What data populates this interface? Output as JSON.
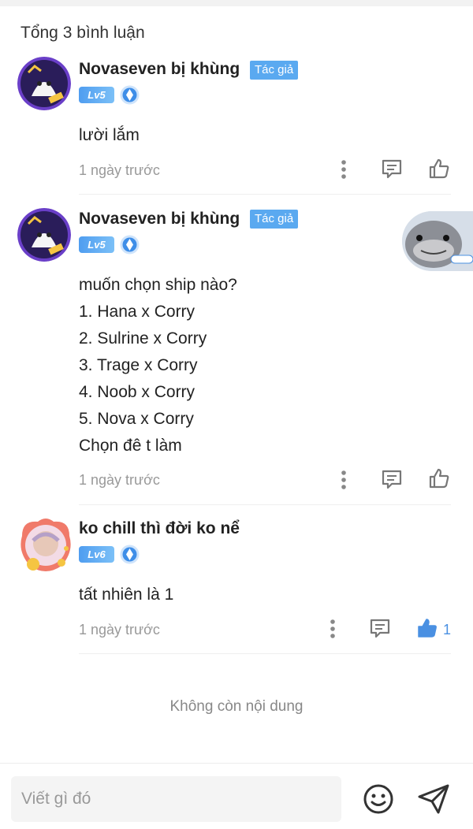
{
  "header": {
    "total": "Tổng 3 bình luận"
  },
  "comments": [
    {
      "author": "Novaseven bị khùng",
      "author_badge": "Tác giả",
      "level": "Lv5",
      "text": "lười lắm",
      "time": "1 ngày trước",
      "likes": ""
    },
    {
      "author": "Novaseven bị khùng",
      "author_badge": "Tác giả",
      "level": "Lv5",
      "text": "muốn chọn ship nào?\n1. Hana x Corry\n2. Sulrine x Corry\n3. Trage x Corry\n4. Noob x Corry\n5. Nova x Corry\nChọn đê t làm",
      "time": "1 ngày trước",
      "likes": ""
    },
    {
      "author": "ko chill thì đời ko nể",
      "author_badge": "",
      "level": "Lv6",
      "text": "tất nhiên là 1",
      "time": "1 ngày trước",
      "likes": "1"
    }
  ],
  "footer_note": "Không còn nội dung",
  "composer": {
    "placeholder": "Viết gì đó"
  },
  "colors": {
    "accent": "#4a90e2",
    "badge": "#5aa9f0",
    "muted": "#999999"
  }
}
